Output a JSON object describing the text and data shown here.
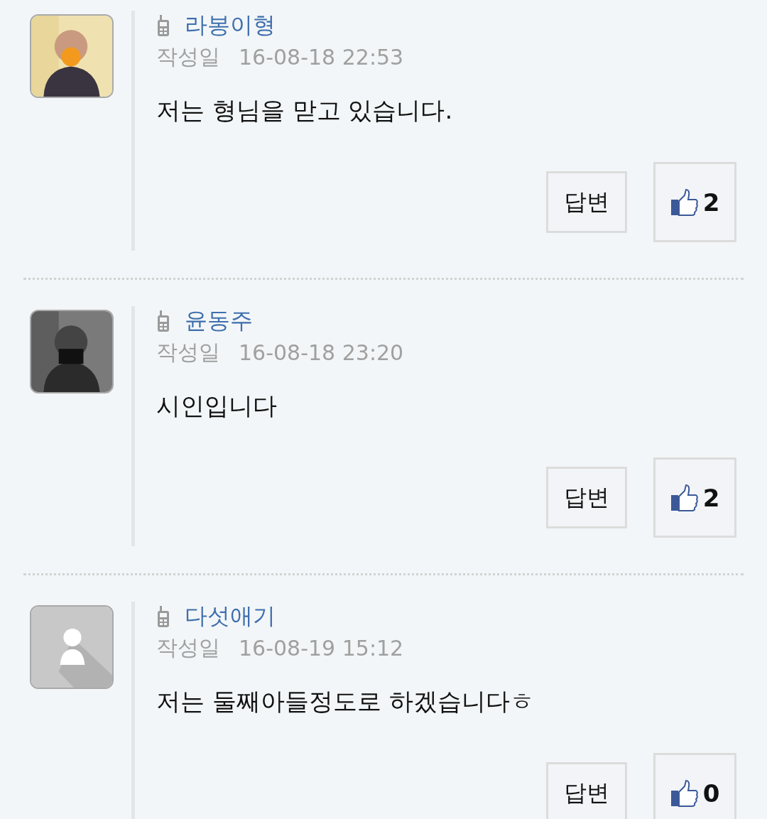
{
  "comments": [
    {
      "author": "라봉이형",
      "date_label": "작성일",
      "date": "16-08-18 22:53",
      "body": "저는 형님을 맏고 있습니다.",
      "reply_button": "답변",
      "likes": "2"
    },
    {
      "author": "윤동주",
      "date_label": "작성일",
      "date": "16-08-18 23:20",
      "body": "시인입니다",
      "reply_button": "답변",
      "likes": "2"
    },
    {
      "avatar": {
        "kind": "default"
      },
      "author": "다섯애기",
      "date_label": "작성일",
      "date": "16-08-19 15:12",
      "body": "저는 둘째아들정도로 하겠습니다ㅎ",
      "reply_button": "답변",
      "likes": "0"
    }
  ]
}
